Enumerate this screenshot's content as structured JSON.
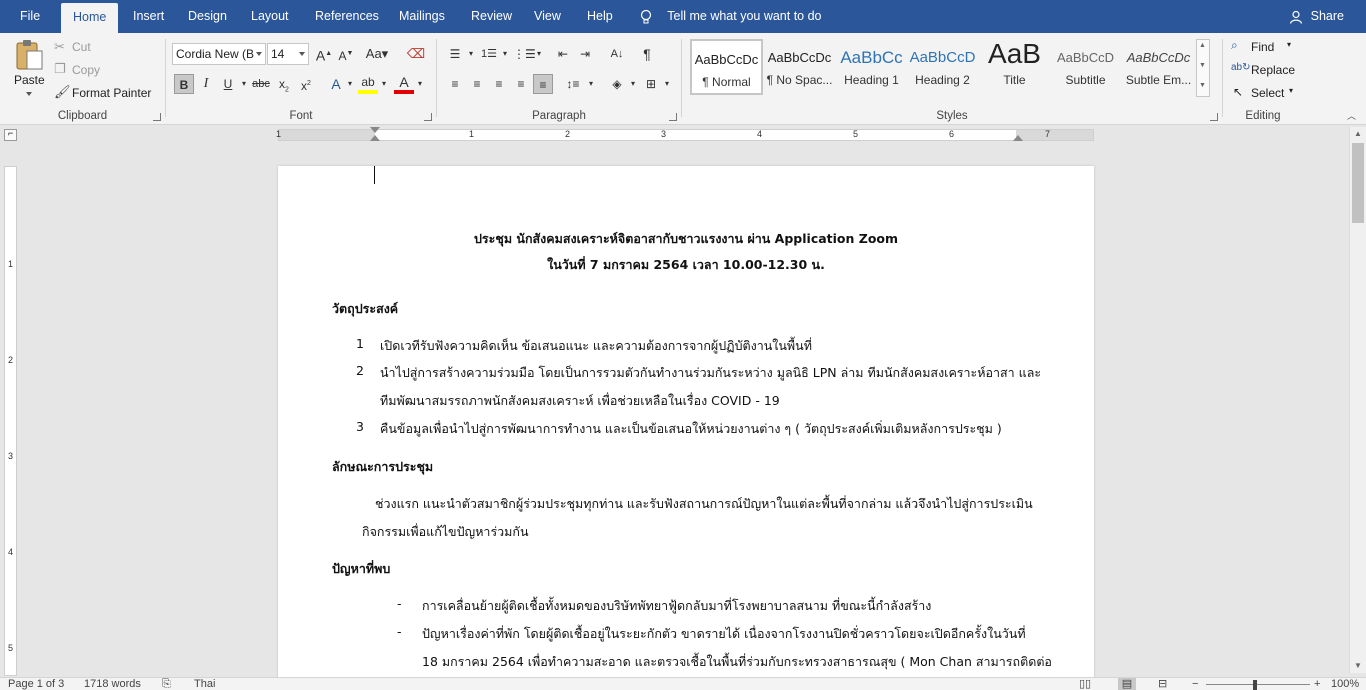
{
  "tabs": [
    {
      "label": "File",
      "active": false
    },
    {
      "label": "Home",
      "active": true
    },
    {
      "label": "Insert",
      "active": false
    },
    {
      "label": "Design",
      "active": false
    },
    {
      "label": "Layout",
      "active": false
    },
    {
      "label": "References",
      "active": false
    },
    {
      "label": "Mailings",
      "active": false
    },
    {
      "label": "Review",
      "active": false
    },
    {
      "label": "View",
      "active": false
    },
    {
      "label": "Help",
      "active": false
    }
  ],
  "tell_me": "Tell me what you want to do",
  "share": "Share",
  "clipboard": {
    "paste": "Paste",
    "cut": "Cut",
    "copy": "Copy",
    "format_painter": "Format Painter",
    "label": "Clipboard"
  },
  "font": {
    "name": "Cordia New (B",
    "size": "14",
    "label": "Font"
  },
  "paragraph": {
    "label": "Paragraph"
  },
  "styles": {
    "label": "Styles",
    "items": [
      {
        "preview": "AaBbCcDc",
        "name": "¶ Normal"
      },
      {
        "preview": "AaBbCcDc",
        "name": "¶ No Spac..."
      },
      {
        "preview": "AaBbCc",
        "name": "Heading 1"
      },
      {
        "preview": "AaBbCcD",
        "name": "Heading 2"
      },
      {
        "preview": "AaB",
        "name": "Title"
      },
      {
        "preview": "AaBbCcD",
        "name": "Subtitle"
      },
      {
        "preview": "AaBbCcDc",
        "name": "Subtle Em..."
      }
    ]
  },
  "editing": {
    "find": "Find",
    "replace": "Replace",
    "select": "Select",
    "label": "Editing"
  },
  "ruler_numbers": [
    "1",
    "1",
    "2",
    "3",
    "4",
    "5",
    "6",
    "7"
  ],
  "vruler_numbers": [
    "1",
    "2",
    "3",
    "4",
    "5"
  ],
  "document": {
    "title_line1": "ประชุม นักสังคมสงเคราะห์จิตอาสากับชาวแรงงาน ผ่าน Application Zoom",
    "title_line2": "ในวันที่ 7 มกราคม 2564 เวลา 10.00-12.30 น.",
    "heading_objectives": "วัตถุประสงค์",
    "objectives": [
      {
        "num": "1",
        "text": "เปิดเวทีรับฟังความคิดเห็น ข้อเสนอแนะ และความต้องการจากผู้ปฏิบัติงานในพื้นที่"
      },
      {
        "num": "2",
        "text": "นำไปสู่การสร้างความร่วมมือ โดยเป็นการรวมตัวกันทำงานร่วมกันระหว่าง มูลนิธิ LPN ล่าม ทีมนักสังคมสงเคราะห์อาสา และ"
      },
      {
        "num": "",
        "text": "ทีมพัฒนาสมรรถภาพนักสังคมสงเคราะห์ เพื่อช่วยเหลือในเรื่อง COVID - 19"
      },
      {
        "num": "3",
        "text": "คืนข้อมูลเพื่อนำไปสู่การพัฒนาการทำงาน และเป็นข้อเสนอให้หน่วยงานต่าง ๆ ( วัตถุประสงค์เพิ่มเติมหลังการประชุม )"
      }
    ],
    "heading_nature": "ลักษณะการประชุม",
    "nature_line1": "ช่วงแรก แนะนำตัวสมาชิกผู้ร่วมประชุมทุกท่าน และรับฟังสถานการณ์ปัญหาในแต่ละพื้นที่จากล่าม แล้วจึงนำไปสู่การประเมิน",
    "nature_line2": "กิจกรรมเพื่อแก้ไขปัญหาร่วมกัน",
    "heading_problems": "ปัญหาที่พบ",
    "problems": [
      {
        "bullet": "-",
        "text": "การเคลื่อนย้ายผู้ติดเชื้อทั้งหมดของบริษัทพัทยาฟู้ดกลับมาที่โรงพยาบาลสนาม ที่ขณะนี้กำลังสร้าง"
      },
      {
        "bullet": "-",
        "text": "ปัญหาเรื่องค่าที่พัก โดยผู้ติดเชื้ออยู่ในระยะกักตัว ขาดรายได้ เนื่องจากโรงงานปิดชั่วคราวโดยจะเปิดอีกครั้งในวันที่"
      },
      {
        "bullet": "",
        "text": "18 มกราคม 2564 เพื่อทำความสะอาด และตรวจเชื้อในพื้นที่ร่วมกับกระทรวงสาธารณสุข ( Mon Chan สามารถติดต่อ"
      }
    ]
  },
  "status": {
    "page": "Page 1 of 3",
    "words": "1718 words",
    "language": "Thai",
    "zoom": "100%"
  }
}
